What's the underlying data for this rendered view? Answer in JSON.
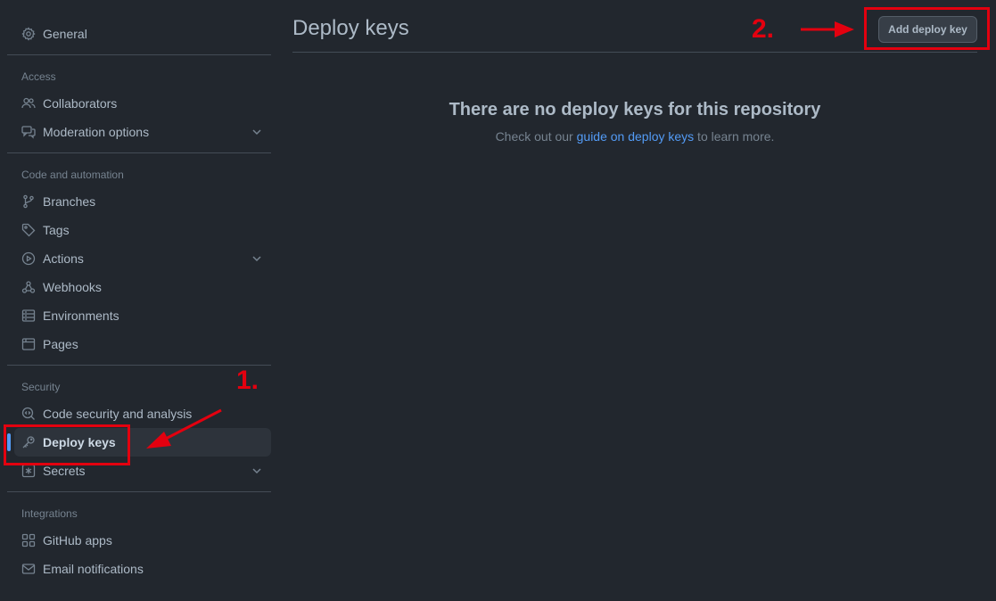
{
  "sidebar": {
    "general": "General",
    "sections": {
      "access": "Access",
      "code": "Code and automation",
      "security": "Security",
      "integrations": "Integrations"
    },
    "items": {
      "collaborators": "Collaborators",
      "moderation": "Moderation options",
      "branches": "Branches",
      "tags": "Tags",
      "actions": "Actions",
      "webhooks": "Webhooks",
      "environments": "Environments",
      "pages": "Pages",
      "code_security": "Code security and analysis",
      "deploy_keys": "Deploy keys",
      "secrets": "Secrets",
      "github_apps": "GitHub apps",
      "email_notifications": "Email notifications"
    }
  },
  "main": {
    "title": "Deploy keys",
    "add_button": "Add deploy key",
    "blankslate_title": "There are no deploy keys for this repository",
    "blankslate_prefix": "Check out our ",
    "blankslate_link": "guide on deploy keys",
    "blankslate_suffix": " to learn more."
  },
  "annotations": {
    "step1": "1.",
    "step2": "2."
  },
  "colors": {
    "background": "#22272e",
    "accent": "#539bf5",
    "annotation": "#e3000f"
  }
}
